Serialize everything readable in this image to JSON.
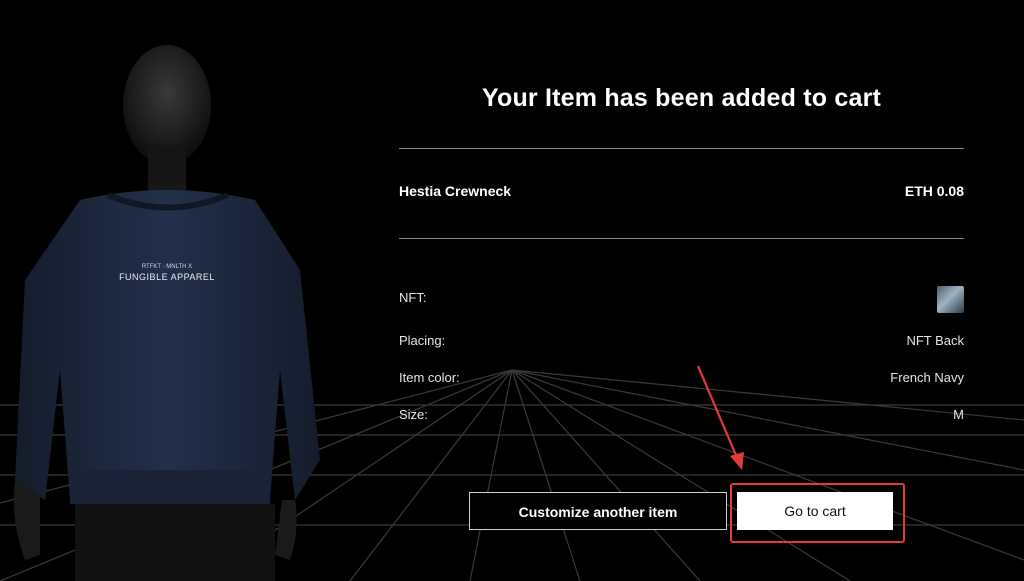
{
  "modal": {
    "title": "Your Item has been added to cart"
  },
  "product": {
    "name": "Hestia Crewneck",
    "price": "ETH 0.08"
  },
  "details": [
    {
      "label": "NFT:",
      "value": ""
    },
    {
      "label": "Placing:",
      "value": "NFT Back"
    },
    {
      "label": "Item color:",
      "value": "French Navy"
    },
    {
      "label": "Size:",
      "value": "M"
    }
  ],
  "sweater_print": {
    "line1": "RTFKT · MNLTH X",
    "line2": "FUNGIBLE APPAREL"
  },
  "buttons": {
    "customize": "Customize another item",
    "go_to_cart": "Go to cart"
  },
  "colors": {
    "background": "#000000",
    "sweater": "#1c2639",
    "annotation": "#e23b3b"
  },
  "icons": [
    "nft-thumbnail",
    "annotation-arrow"
  ]
}
